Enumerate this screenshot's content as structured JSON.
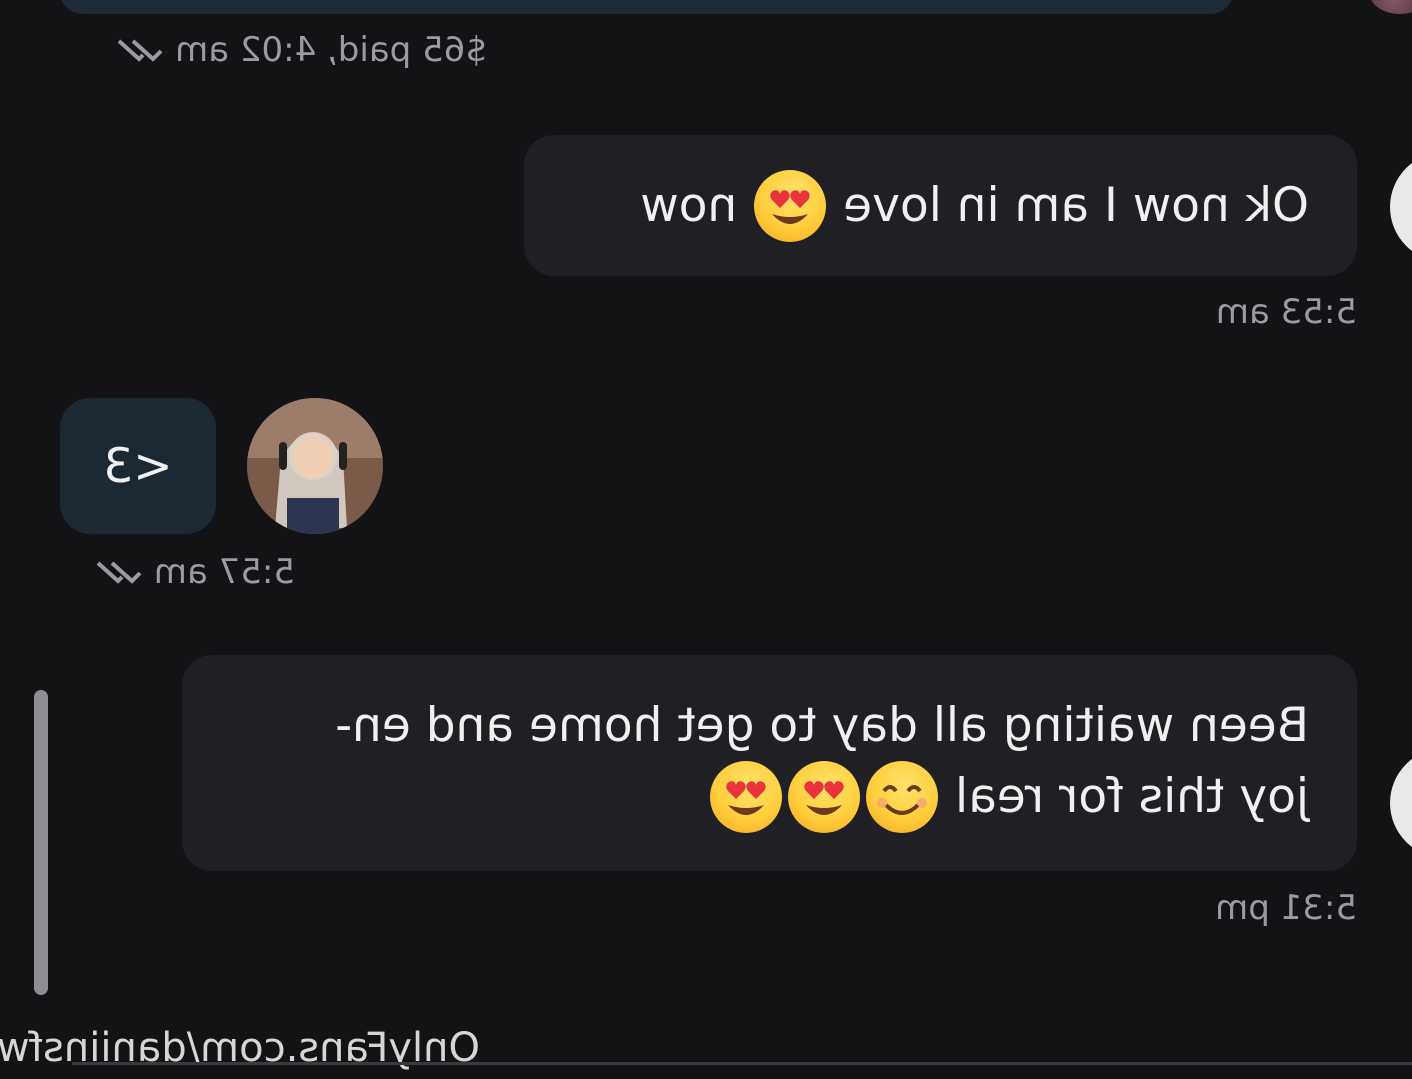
{
  "chat": {
    "top_meta": {
      "text": "$65 paid, 4:02 am",
      "status_icon": "double-check-icon"
    },
    "messages": [
      {
        "text": "Ok now I am in love",
        "text_after": "now",
        "emojis": [
          "heart-eyes-emoji"
        ],
        "time": "5:53 am"
      },
      {
        "text": "<3",
        "time": "5:57 am",
        "status_icon": "double-check-icon",
        "avatar": "creator-avatar"
      },
      {
        "line1": "Been waiting all day to get home and en-",
        "line2": "joy this for real",
        "emojis": [
          "smiling-emoji",
          "heart-eyes-emoji",
          "heart-eyes-emoji"
        ],
        "time": "5:31 pm"
      }
    ]
  },
  "watermark": "OnlyFans.com/daniinsfw",
  "colors": {
    "background": "#131316",
    "sender_bubble": "#202024",
    "reply_bubble": "#1c2832",
    "meta_text": "#9a9aa0"
  }
}
